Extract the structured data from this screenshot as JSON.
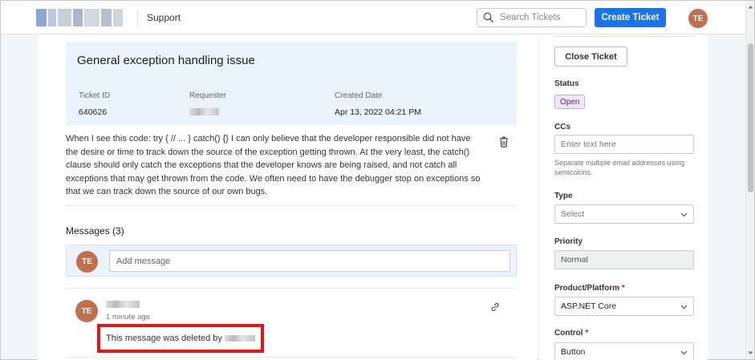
{
  "header": {
    "nav_label": "Support",
    "search_placeholder": "Search Tickets",
    "create_button": "Create Ticket",
    "user_initials": "TE",
    "brand_color": "#1a73e8",
    "avatar_color": "#c0704f"
  },
  "ticket": {
    "title": "General exception handling issue",
    "id_label": "Ticket ID",
    "id_value": "640626",
    "requester_label": "Requester",
    "created_label": "Created Date",
    "created_value": "Apr 13, 2022 04:21 PM",
    "description": "When I see this code: try { // ... } catch() {} I can only believe that the developer responsible did not have the desire or time to track down the source of the exception getting thrown. At the very least, the catch() clause should only catch the exceptions that the developer knows are being raised, and not catch all exceptions that may get thrown from the code. We often need to have the debugger stop on exceptions so that we can track down the source of our own bugs."
  },
  "messages": {
    "heading": "Messages (3)",
    "compose_initials": "TE",
    "compose_placeholder": "Add message",
    "items": [
      {
        "initials": "TE",
        "time": "1 minute ago",
        "text": "This message was deleted by",
        "highlight_color": "#e8141c"
      }
    ]
  },
  "sidebar": {
    "close_button": "Close Ticket",
    "status_label": "Status",
    "status_value": "Open",
    "ccs_label": "CCs",
    "ccs_placeholder": "Enter text here",
    "ccs_hint": "Separate multiple email addresses using semicolons.",
    "type_label": "Type",
    "type_value": "Select",
    "priority_label": "Priority",
    "priority_value": "Normal",
    "product_label": "Product/Platform",
    "product_value": "ASP.NET Core",
    "control_label": "Control",
    "control_value": "Button",
    "required_mark": "*"
  }
}
